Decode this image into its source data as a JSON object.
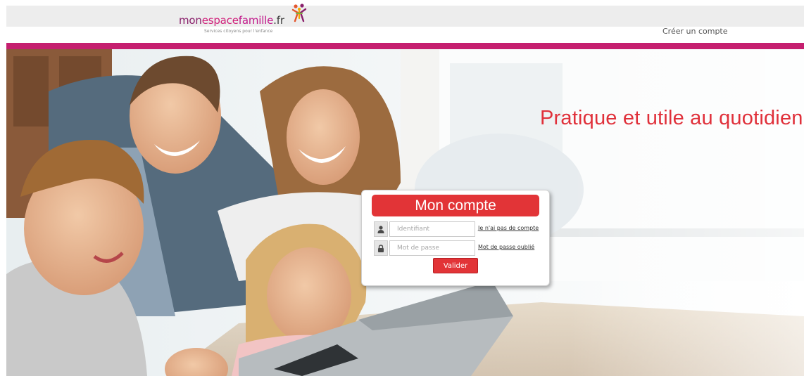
{
  "brand": {
    "logo_parts": [
      "mon",
      "espace",
      "famille",
      ".fr"
    ],
    "tagline": "Services citoyens pour l'enfance"
  },
  "header": {
    "create_account_label": "Créer un compte"
  },
  "hero": {
    "slogan": "Pratique et utile au quotidien"
  },
  "login": {
    "title": "Mon compte",
    "username": {
      "value": "",
      "placeholder": "Identifiant",
      "icon": "user-icon"
    },
    "password": {
      "value": "",
      "placeholder": "Mot de passe",
      "icon": "lock-icon"
    },
    "no_account_link": "Je n'ai pas de compte",
    "forgot_password_link": "Mot de passe oublié",
    "submit_label": "Valider"
  },
  "colors": {
    "accent_bar": "#c51f6f",
    "brand_red": "#e23437",
    "slogan": "#e0303a",
    "header_band": "#ededed"
  }
}
